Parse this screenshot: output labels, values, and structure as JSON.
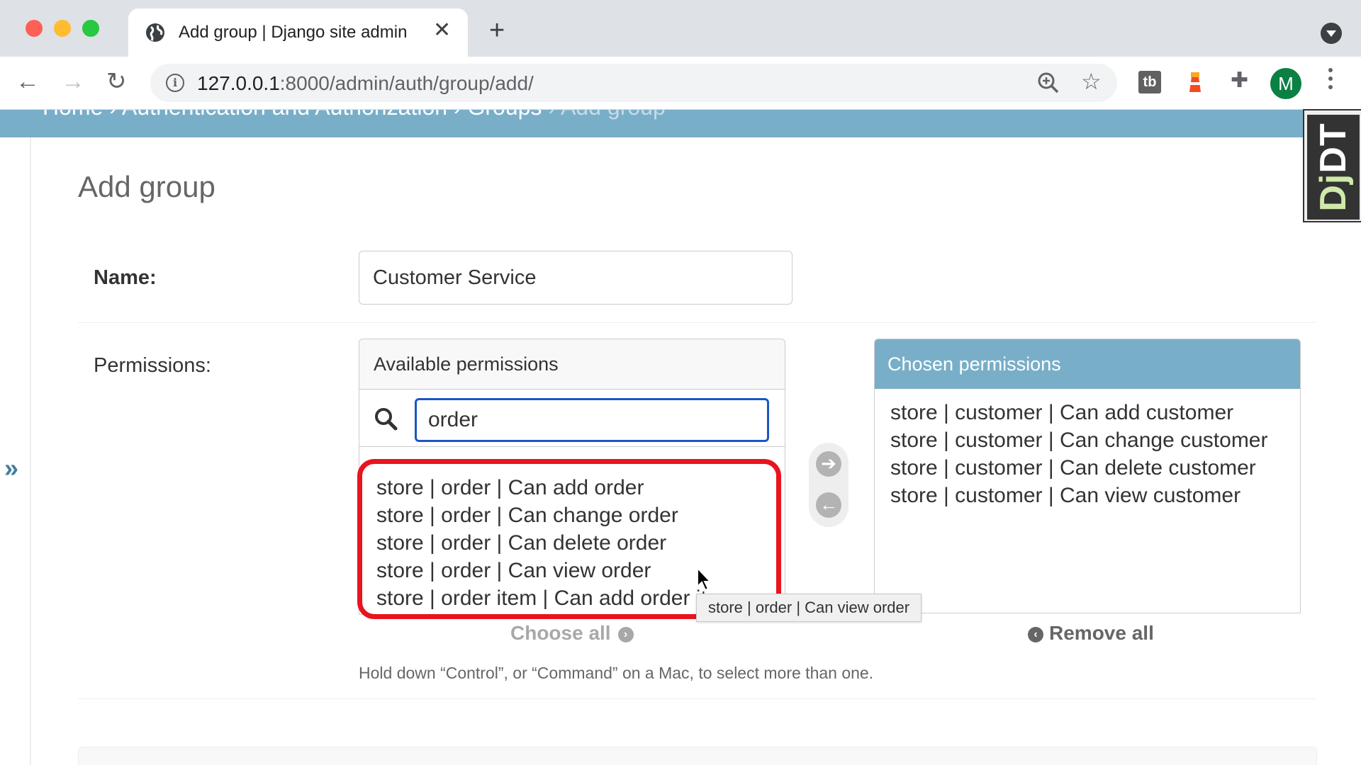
{
  "browser": {
    "tab_title": "Add group | Django site admin",
    "tab_close": "✕",
    "new_tab": "+",
    "url_host": "127.0.0.1",
    "url_path": ":8000/admin/auth/group/add/",
    "info_glyph": "i",
    "star_glyph": "☆",
    "ext_tb": "tb",
    "puzzle_glyph": "✚",
    "profile_initial": "M",
    "back_glyph": "←",
    "forward_glyph": "→",
    "reload_glyph": "↻"
  },
  "breadcrumbs": {
    "home": "Home",
    "sep": " › ",
    "app": "Authentication and Authorization",
    "model": "Groups",
    "current": "Add group"
  },
  "sidebar": {
    "toggle": "»"
  },
  "page": {
    "title": "Add group"
  },
  "form": {
    "name_label": "Name:",
    "name_value": "Customer Service",
    "permissions_label": "Permissions:",
    "available_title": "Available permissions",
    "filter_value": "order",
    "available_items": [
      "store | order | Can add order",
      "store | order | Can change order",
      "store | order | Can delete order",
      "store | order | Can view order",
      "store | order item | Can add order item"
    ],
    "chosen_title": "Chosen permissions",
    "chosen_items": [
      "store | customer | Can add customer",
      "store | customer | Can change customer",
      "store | customer | Can delete customer",
      "store | customer | Can view customer"
    ],
    "choose_all": "Choose all",
    "remove_all": "Remove all",
    "arrow_right": "➔",
    "arrow_left": "←",
    "help_text": "Hold down “Control”, or “Command” on a Mac, to select more than one."
  },
  "tooltip": "store | order | Can view order",
  "djdt": {
    "part1": "Dj",
    "part2": "DT"
  },
  "colors": {
    "breadcrumb_bg": "#79aec8",
    "chosen_header_bg": "#79aec8",
    "highlight_border": "#e8141e",
    "filter_focus": "#1a56c5"
  }
}
